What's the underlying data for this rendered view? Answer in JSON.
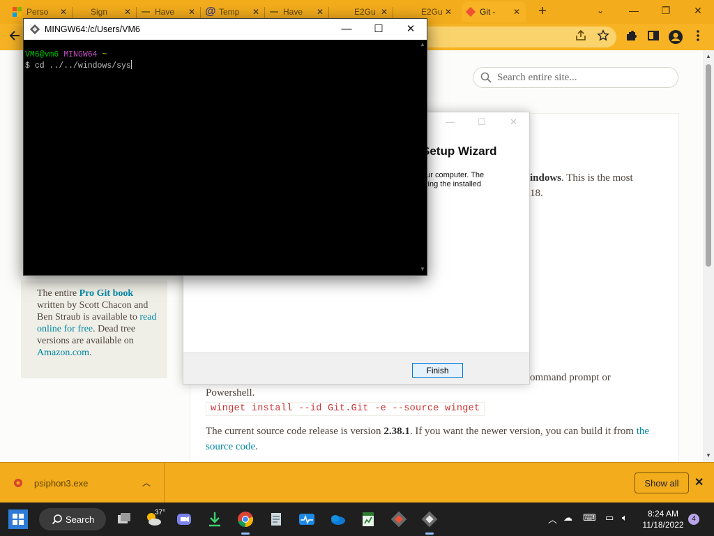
{
  "browser": {
    "tabs": [
      {
        "title": "Perso",
        "favicon": "microsoft-icon"
      },
      {
        "title": "Sign",
        "favicon": "generic-page-icon"
      },
      {
        "title": "Have",
        "favicon": "site-icon"
      },
      {
        "title": "Temp",
        "favicon": "at-sign-icon"
      },
      {
        "title": "Have",
        "favicon": "site-icon"
      },
      {
        "title": "E2Gu",
        "favicon": "none"
      },
      {
        "title": "E2Gu",
        "favicon": "none"
      },
      {
        "title": "Git -",
        "favicon": "git-icon",
        "active": true
      }
    ],
    "new_tab_label": "+",
    "window_controls": {
      "dropdown": "⌄",
      "minimize": "—",
      "restore": "❐",
      "close": "✕"
    },
    "toolbar_icons": [
      "back-arrow-icon",
      "share-icon",
      "star-icon",
      "extensions-icon",
      "sidepanel-icon",
      "profile-icon",
      "menu-icon"
    ],
    "theme_color": "#f2ac1c"
  },
  "page": {
    "search_placeholder": "Search entire site...",
    "book": {
      "pre": "The entire ",
      "title": "Pro Git book",
      "mid": " written by Scott Chacon and Ben Straub is available to ",
      "link": "read online for free",
      "post": ". Dead tree versions are available on ",
      "store": "Amazon.com",
      "end": "."
    },
    "frag_windows_bold": "indows",
    "frag_windows_rest": ". This is the most",
    "frag_version_end": "18.",
    "frag_cmd": "ommand prompt or",
    "powershell": "Powershell.",
    "winget_cmd": "winget install --id Git.Git -e --source winget",
    "source_pre": "The current source code release is version ",
    "source_ver": "2.38.1",
    "source_mid": ". If you want the newer version, you can build it from ",
    "source_link1": "the",
    "source_link2": "source code",
    "source_end": "."
  },
  "wizard": {
    "title": "Setup Wizard",
    "line1": "our computer. The",
    "line2": "cting the installed",
    "finish_label": "Finish",
    "controls": {
      "minimize": "—",
      "maximize": "☐",
      "close": "✕"
    }
  },
  "terminal": {
    "title": "MINGW64:/c/Users/VM6",
    "user_host": "VM6@vm6",
    "system": "MINGW64",
    "cwd": "~",
    "prompt": "$",
    "command": "cd ../../windows/sys",
    "controls": {
      "minimize": "—",
      "maximize": "☐",
      "close": "✕"
    }
  },
  "downloads": {
    "file_name": "psiphon3.exe",
    "show_all_label": "Show all",
    "close_label": "✕"
  },
  "taskbar": {
    "search_label": "Search",
    "weather_temp": "37°",
    "time": "8:24 AM",
    "date": "11/18/2022",
    "notification_count": "4"
  }
}
